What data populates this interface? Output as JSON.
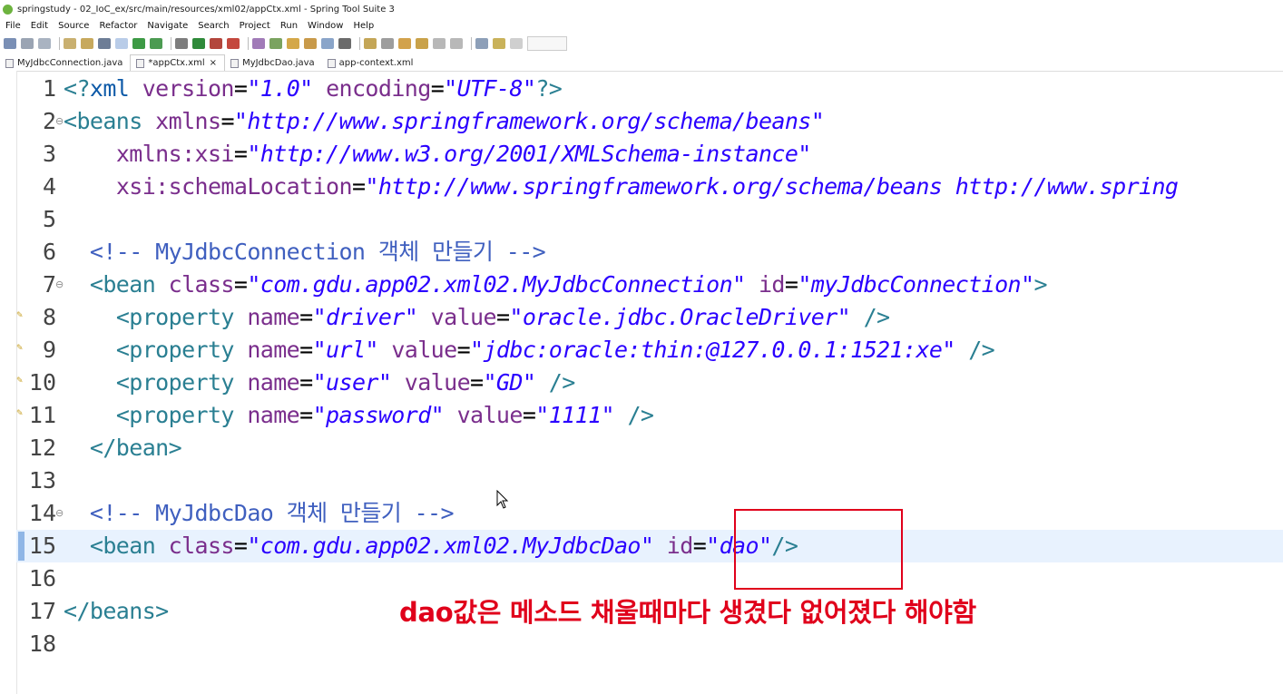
{
  "window": {
    "title": "springstudy - 02_IoC_ex/src/main/resources/xml02/appCtx.xml - Spring Tool Suite 3"
  },
  "menu": [
    "File",
    "Edit",
    "Source",
    "Refactor",
    "Navigate",
    "Search",
    "Project",
    "Run",
    "Window",
    "Help"
  ],
  "tabs": [
    {
      "label": "MyJdbcConnection.java",
      "active": false
    },
    {
      "label": "*appCtx.xml",
      "active": true,
      "close": "×"
    },
    {
      "label": "MyJdbcDao.java",
      "active": false
    },
    {
      "label": "app-context.xml",
      "active": false
    }
  ],
  "editor": {
    "line_numbers": [
      "1",
      "2",
      "3",
      "4",
      "5",
      "6",
      "7",
      "8",
      "9",
      "10",
      "11",
      "12",
      "13",
      "14",
      "15",
      "16",
      "17",
      "18"
    ],
    "current_line": "15"
  },
  "annotation": {
    "text": "dao값은 메소드 채울때마다 생겼다 없어졌다 해야함",
    "color": "#e0001b"
  },
  "colors": {
    "tag": "#0e5aa8",
    "attribute": "#7a2e8c",
    "value": "#2a00ff",
    "comment": "#3f5fbf",
    "current_line_bg": "#e8f2fe"
  }
}
